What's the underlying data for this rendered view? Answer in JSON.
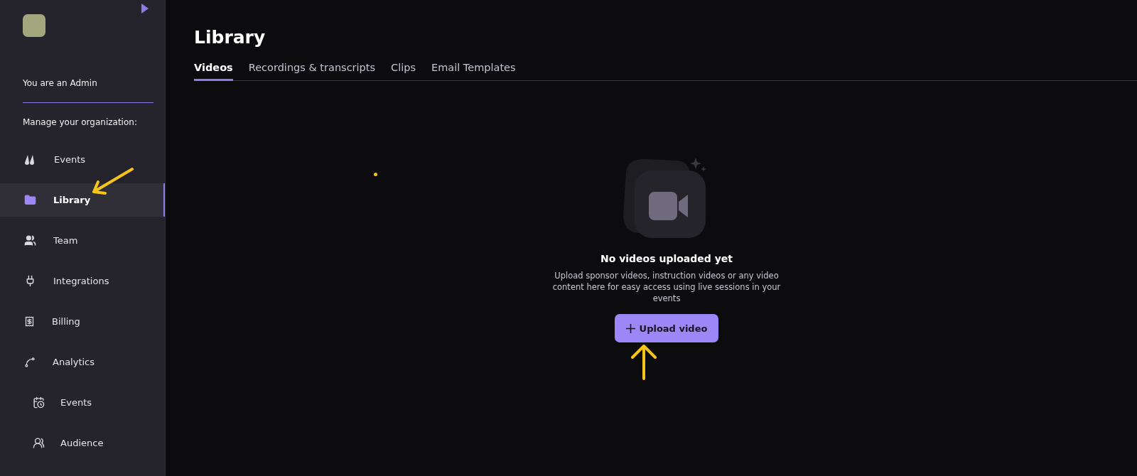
{
  "sidebar": {
    "role": "You are an Admin",
    "section_label": "Manage your organization:",
    "items": [
      {
        "label": "Events",
        "selected": false
      },
      {
        "label": "Library",
        "selected": true
      },
      {
        "label": "Team",
        "selected": false
      },
      {
        "label": "Integrations",
        "selected": false
      },
      {
        "label": "Billing",
        "selected": false
      },
      {
        "label": "Analytics",
        "selected": false,
        "children": [
          {
            "label": "Events",
            "selected": false
          },
          {
            "label": "Audience",
            "selected": false
          }
        ]
      }
    ]
  },
  "page": {
    "title": "Library",
    "tabs": [
      {
        "label": "Videos",
        "selected": true
      },
      {
        "label": "Recordings & transcripts",
        "selected": false
      },
      {
        "label": "Clips",
        "selected": false
      },
      {
        "label": "Email Templates",
        "selected": false
      }
    ],
    "empty_state": {
      "title": "No videos uploaded yet",
      "description": "Upload sponsor videos, instruction videos or any video content here for easy access using live sessions in your events",
      "button": "Upload video"
    }
  }
}
